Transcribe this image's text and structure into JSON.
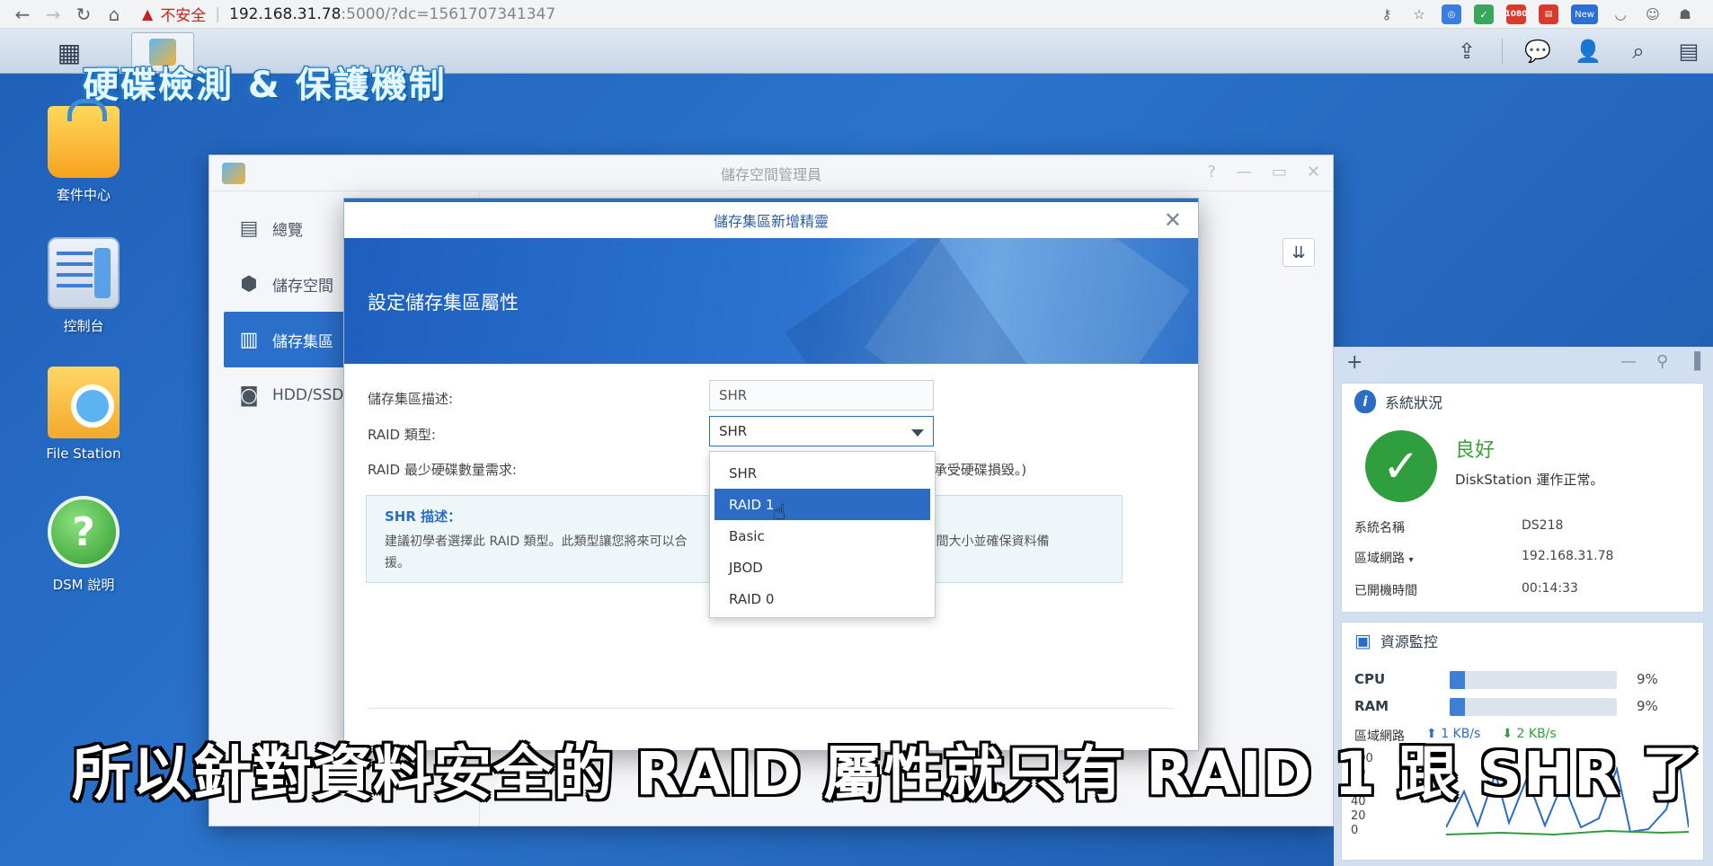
{
  "browser": {
    "insecure_label": "不安全",
    "url_host": "192.168.31.78",
    "url_rest": ":5000/?dc=1561707341347",
    "new_badge": "New",
    "ext_1080": "1080"
  },
  "overlay_title": "硬碟檢測 & 保護機制",
  "desktop": {
    "icons": [
      {
        "label": "套件中心"
      },
      {
        "label": "控制台"
      },
      {
        "label": "File Station"
      },
      {
        "label": "DSM 說明"
      }
    ]
  },
  "storage_window": {
    "title": "儲存空間管理員",
    "sidebar": [
      {
        "label": "總覽"
      },
      {
        "label": "儲存空間"
      },
      {
        "label": "儲存集區"
      },
      {
        "label": "HDD/SSD"
      }
    ]
  },
  "wizard": {
    "title": "儲存集區新增精靈",
    "heading": "設定儲存集區屬性",
    "fields": {
      "desc_label": "儲存集區描述:",
      "desc_value": "SHR",
      "raid_label": "RAID 類型:",
      "raid_value": "SHR",
      "min_label": "RAID 最少硬碟數量需求:",
      "min_hint_tail": "承受硬碟損毀。)"
    },
    "desc_box": {
      "title": "SHR 描述：",
      "text": "建議初學者選擇此 RAID 類型。此類型讓您將來可以合",
      "text_tail": "儲存空間大小並確保資料備",
      "text_line2": "援。"
    },
    "dropdown": {
      "options": [
        "SHR",
        "RAID 1",
        "Basic",
        "JBOD",
        "RAID 0"
      ],
      "selected": "RAID 1"
    }
  },
  "system_status": {
    "title": "系統狀況",
    "status": "良好",
    "status_text": "DiskStation 運作正常。",
    "rows": [
      {
        "key": "系統名稱",
        "value": "DS218"
      },
      {
        "key": "區域網路",
        "value": "192.168.31.78"
      },
      {
        "key": "已開機時間",
        "value": "00:14:33"
      }
    ]
  },
  "resource_monitor": {
    "title": "資源監控",
    "cpu_label": "CPU",
    "cpu_percent": 9,
    "cpu_text": "9%",
    "ram_label": "RAM",
    "ram_percent": 9,
    "ram_text": "9%",
    "net_label": "區域網路",
    "net_up": "1 KB/s",
    "net_down": "2 KB/s",
    "axis": [
      "100",
      "80",
      "60",
      "40",
      "20",
      "0"
    ]
  },
  "subtitle": "所以針對資料安全的 RAID 屬性就只有 RAID 1 跟 SHR 了",
  "colors": {
    "accent": "#2c6cc4",
    "ok": "#2e9e3e",
    "desktop": "#2467bd"
  }
}
